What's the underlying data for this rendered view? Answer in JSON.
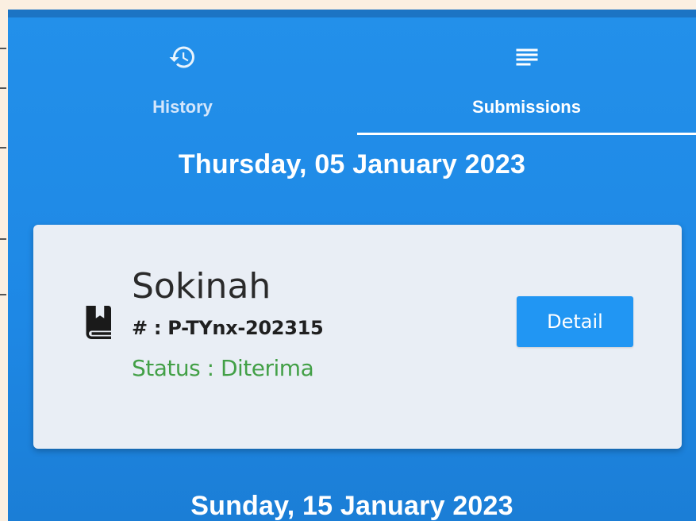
{
  "tabs": [
    {
      "label": "History",
      "icon": "history-icon"
    },
    {
      "label": "Submissions",
      "icon": "list-icon"
    }
  ],
  "active_tab": "Submissions",
  "groups": [
    {
      "date": "Thursday, 05 January 2023",
      "items": [
        {
          "name": "Sokinah",
          "code": "# : P-TYnx-202315",
          "status": "Status : Diterima",
          "icon": "book-icon",
          "action_label": "Detail"
        }
      ]
    },
    {
      "date": "Sunday, 15 January 2023",
      "items": []
    }
  ],
  "colors": {
    "background": "#1e88e5",
    "card": "#e9eef5",
    "status_accepted": "#43a047",
    "button": "#2196f3"
  }
}
